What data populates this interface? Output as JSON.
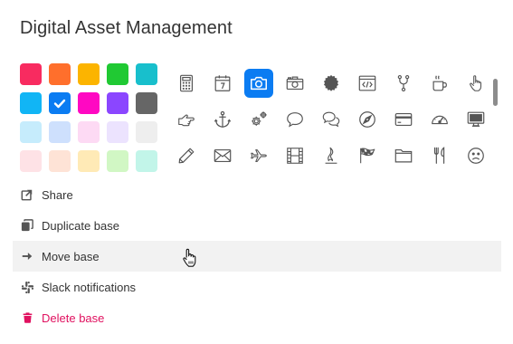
{
  "popover": {
    "title": "Digital Asset Management"
  },
  "colors": {
    "swatches": [
      {
        "name": "red",
        "hex": "#f82b60"
      },
      {
        "name": "orange",
        "hex": "#ff6f2c"
      },
      {
        "name": "yellow",
        "hex": "#fcb400"
      },
      {
        "name": "green",
        "hex": "#20c933"
      },
      {
        "name": "teal",
        "hex": "#18bfcc"
      },
      {
        "name": "cyan",
        "hex": "#11b5f5"
      },
      {
        "name": "blue",
        "hex": "#0b7cf2",
        "selected": true
      },
      {
        "name": "pink",
        "hex": "#ff08c2"
      },
      {
        "name": "purple",
        "hex": "#8b46ff"
      },
      {
        "name": "gray",
        "hex": "#666666"
      },
      {
        "name": "light-cyan",
        "hex": "#c6ecfc"
      },
      {
        "name": "light-blue",
        "hex": "#cee0fd"
      },
      {
        "name": "light-pink",
        "hex": "#fddaf4"
      },
      {
        "name": "light-purple",
        "hex": "#ece3fe"
      },
      {
        "name": "light-gray",
        "hex": "#eeeeee"
      },
      {
        "name": "light-red",
        "hex": "#fee2e6"
      },
      {
        "name": "light-orange",
        "hex": "#fee3d6"
      },
      {
        "name": "light-yellow",
        "hex": "#ffeab6"
      },
      {
        "name": "light-green",
        "hex": "#d1f7c4"
      },
      {
        "name": "light-teal",
        "hex": "#c2f5e9"
      }
    ],
    "selected_check": "check-icon"
  },
  "icons": {
    "selected": "camera-icon",
    "rows": [
      [
        "calculator-icon",
        "calendar-icon",
        "camera-icon",
        "camera-retro-icon",
        "certificate-icon",
        "code-window-icon",
        "code-fork-icon",
        "coffee-icon",
        "pointer-hand-icon"
      ],
      [
        "hand-right-icon",
        "anchor-icon",
        "gears-icon",
        "speech-bubble-icon",
        "chat-bubbles-icon",
        "compass-icon",
        "credit-card-icon",
        "dashboard-icon",
        "desktop-icon"
      ],
      [
        "pencil-icon",
        "envelope-icon",
        "airplane-icon",
        "film-icon",
        "fire-icon",
        "flag-checkered-icon",
        "folder-icon",
        "cutlery-icon",
        "frown-icon"
      ]
    ]
  },
  "menu": {
    "items": [
      {
        "label": "Share",
        "icon": "share-icon"
      },
      {
        "label": "Duplicate base",
        "icon": "duplicate-icon"
      },
      {
        "label": "Move base",
        "icon": "arrow-right-icon",
        "hovered": true
      },
      {
        "label": "Slack notifications",
        "icon": "slack-icon"
      },
      {
        "label": "Delete base",
        "icon": "trash-icon",
        "danger": true
      }
    ],
    "danger_color": "#e0115f"
  },
  "cursor": "hand-cursor-icon"
}
